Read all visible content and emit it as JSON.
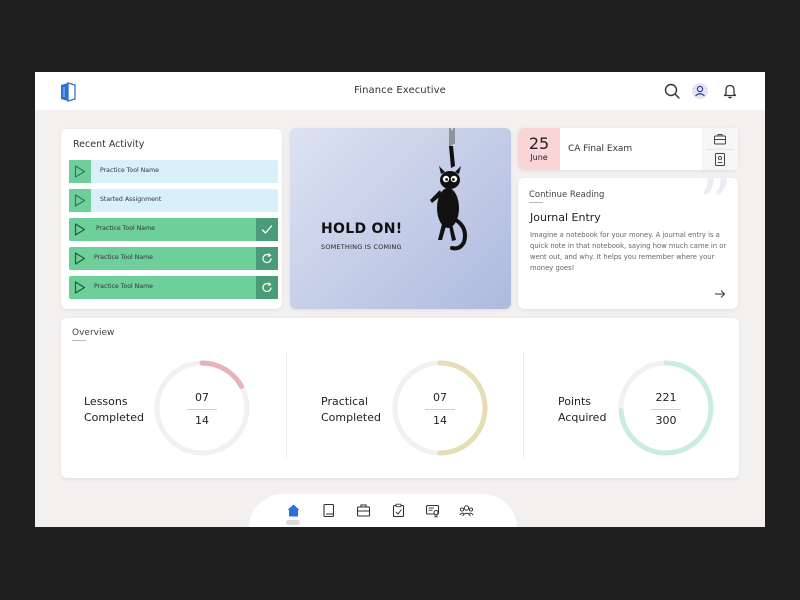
{
  "header": {
    "title": "Finance Executive",
    "icons": [
      "book-logo-icon",
      "search-icon",
      "avatar",
      "bell-icon"
    ]
  },
  "recent_activity": {
    "title": "Recent Activity",
    "items": [
      {
        "label": "Practice Tool Name",
        "status": "none"
      },
      {
        "label": "Started Assignment",
        "status": "none"
      },
      {
        "label": "Practice Tool Name",
        "status": "check"
      },
      {
        "label": "Practice Tool Name",
        "status": "retry"
      },
      {
        "label": "Practice Tool Name",
        "status": "retry"
      }
    ]
  },
  "hold_on": {
    "title": "HOLD ON!",
    "subtitle": "SOMETHING IS COMING"
  },
  "exam": {
    "day": "25",
    "month": "June",
    "label": "CA Final Exam",
    "side_icons": [
      "briefcase-icon",
      "id-card-icon"
    ]
  },
  "continue_reading": {
    "label": "Continue Reading",
    "title": "Journal Entry",
    "body": "Imagine a notebook for your money. A journal entry is a quick note in that notebook, saying how much came in or went out, and why. It helps you remember where your money goes!"
  },
  "overview": {
    "title": "Overview",
    "stats": [
      {
        "label_line1": "Lessons",
        "label_line2": "Completed",
        "value": "07",
        "total": "14",
        "fraction": 0.17,
        "color": "#e8b2bd"
      },
      {
        "label_line1": "Practical",
        "label_line2": "Completed",
        "value": "07",
        "total": "14",
        "fraction": 0.5,
        "color": "#e8ddb4"
      },
      {
        "label_line1": "Points",
        "label_line2": "Acquired",
        "value": "221",
        "total": "300",
        "fraction": 0.74,
        "color": "#c9eede"
      }
    ]
  },
  "bottom_nav": {
    "active": "home",
    "items": [
      "home-icon",
      "book-icon",
      "briefcase-icon",
      "clipboard-icon",
      "certificate-icon",
      "community-icon"
    ]
  },
  "colors": {
    "accent_blue": "#2f6fd6",
    "row_light": "#d8f0fa",
    "row_green": "#6ecf9b",
    "status_dark_green": "#4a9b77",
    "exam_pink": "#f9d5d8"
  }
}
